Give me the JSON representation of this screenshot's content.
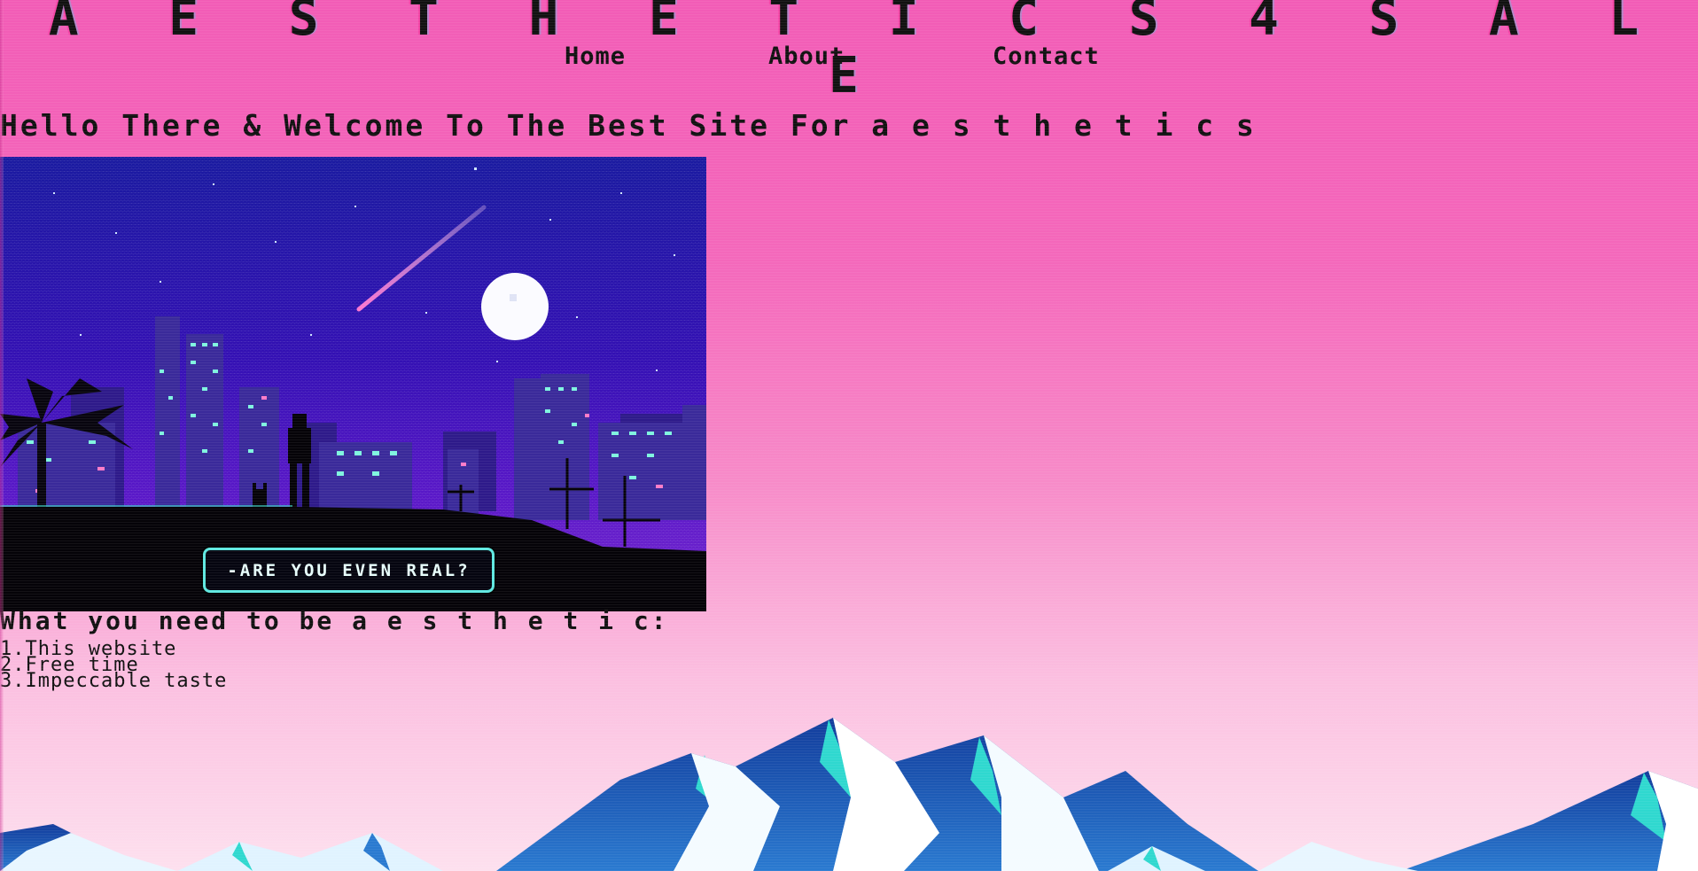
{
  "site": {
    "title": "A E S T H E T I C S 4 S A L E"
  },
  "nav": {
    "items": [
      {
        "label": "Home"
      },
      {
        "label": "About"
      },
      {
        "label": "Contact"
      }
    ]
  },
  "main": {
    "welcome": "Hello There & Welcome To The Best Site For a e s t h e t i c s",
    "hero_caption": "-ARE YOU EVEN REAL?",
    "need_heading": "What you need to be a e s t h e t i c:",
    "need_list": [
      "1.This website",
      "2.Free time",
      "3.Impeccable taste"
    ]
  },
  "colors": {
    "background_top": "#f25cb6",
    "background_bottom": "#fde0ee",
    "hero_sky": "#3b0fb0",
    "caption_border": "#5fe8e0",
    "mountain_blue": "#1f63c0",
    "mountain_teal": "#2fd8cf"
  }
}
